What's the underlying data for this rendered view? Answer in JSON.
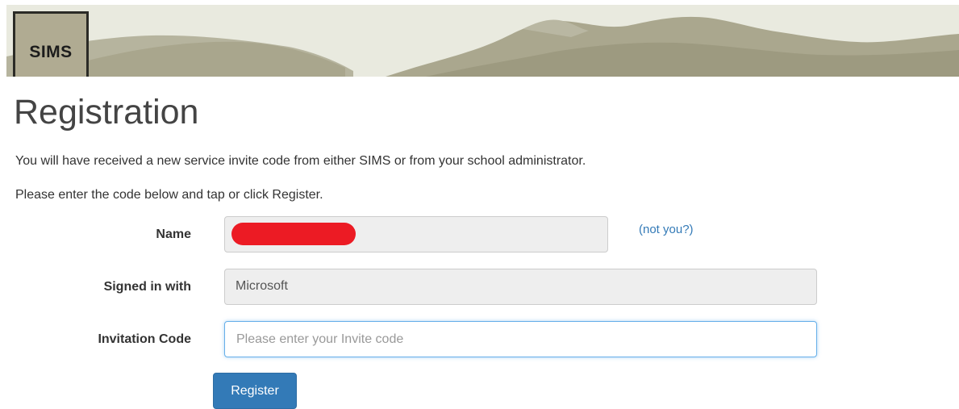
{
  "header": {
    "logo_text": "SIMS"
  },
  "page": {
    "title": "Registration",
    "intro_line_1": "You will have received a new service invite code from either SIMS or from your school administrator.",
    "intro_line_2": "Please enter the code below and tap or click Register."
  },
  "form": {
    "name": {
      "label": "Name",
      "value_redacted": true,
      "not_you_link": "(not you?)"
    },
    "signed_in_with": {
      "label": "Signed in with",
      "value": "Microsoft"
    },
    "invitation_code": {
      "label": "Invitation Code",
      "value": "",
      "placeholder": "Please enter your Invite code"
    },
    "register_button": "Register"
  },
  "colors": {
    "primary_button": "#337ab7",
    "link": "#337ab7",
    "redaction": "#ec1b24",
    "banner_sky": "#e7e8dc",
    "banner_mountains": "#a3a086"
  }
}
